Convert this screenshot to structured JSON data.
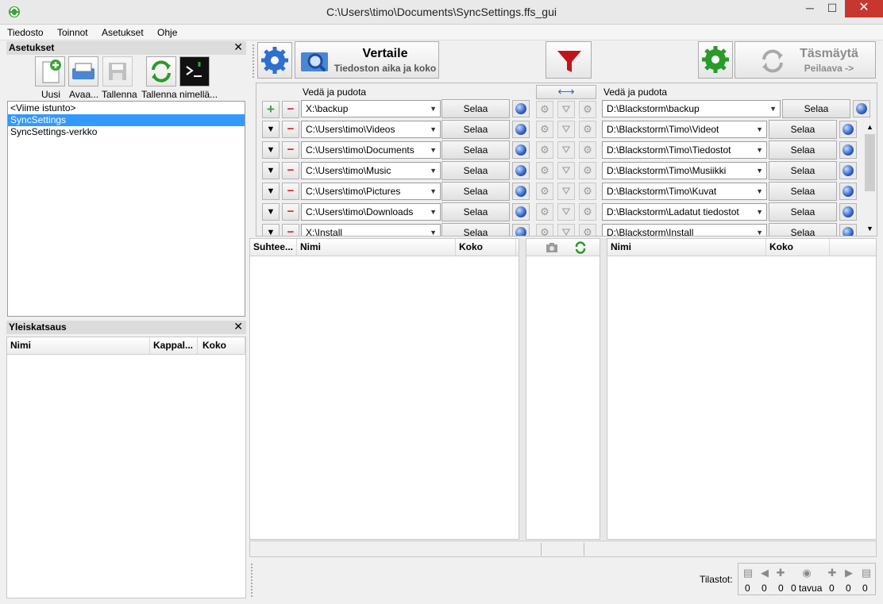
{
  "window": {
    "title": "C:\\Users\\timo\\Documents\\SyncSettings.ffs_gui",
    "minimize": "─",
    "maximize": "☐",
    "close": "✕"
  },
  "menu": [
    "Tiedosto",
    "Toinnot",
    "Asetukset",
    "Ohje"
  ],
  "settings_panel": {
    "title": "Asetukset",
    "close": "✕",
    "buttons": [
      {
        "label": "Uusi"
      },
      {
        "label": "Avaa..."
      },
      {
        "label": "Tallenna"
      },
      {
        "label": "Tallenna nimellä..."
      }
    ],
    "sessions": [
      "<Viime istunto>",
      "SyncSettings",
      "SyncSettings-verkko"
    ],
    "selected": "SyncSettings"
  },
  "overview_panel": {
    "title": "Yleiskatsaus",
    "close": "✕",
    "columns": [
      "Nimi",
      "Kappal...",
      "Koko"
    ]
  },
  "toolbar": {
    "compare_label": "Vertaile",
    "compare_sub": "Tiedoston aika ja koko",
    "sync_label": "Täsmäytä",
    "sync_sub": "Peilaava ->",
    "swap_icon": "⟷"
  },
  "folders": {
    "drag_drop_left": "Vedä ja pudota",
    "drag_drop_right": "Vedä ja pudota",
    "browse": "Selaa",
    "main": {
      "left": "X:\\backup",
      "right": "D:\\Blackstorm\\backup"
    },
    "pairs": [
      {
        "left": "C:\\Users\\timo\\Videos",
        "right": "D:\\Blackstorm\\Timo\\Videot"
      },
      {
        "left": "C:\\Users\\timo\\Documents",
        "right": "D:\\Blackstorm\\Timo\\Tiedostot"
      },
      {
        "left": "C:\\Users\\timo\\Music",
        "right": "D:\\Blackstorm\\Timo\\Musiikki"
      },
      {
        "left": "C:\\Users\\timo\\Pictures",
        "right": "D:\\Blackstorm\\Timo\\Kuvat"
      },
      {
        "left": "C:\\Users\\timo\\Downloads",
        "right": "D:\\Blackstorm\\Ladatut tiedostot"
      },
      {
        "left": "X:\\Install",
        "right": "D:\\Blackstorm\\Install"
      }
    ]
  },
  "grid": {
    "left_columns": [
      "Suhtee...",
      "Nimi",
      "Koko"
    ],
    "right_columns": [
      "Nimi",
      "Koko"
    ]
  },
  "stats": {
    "label": "Tilastot:",
    "values": [
      "0",
      "0",
      "0",
      "0 tavua",
      "0",
      "0",
      "0"
    ]
  },
  "colors": {
    "selection": "#3399ff",
    "close_button": "#c7372f",
    "filter_red": "#c0141c",
    "sync_green": "#2a9a2a"
  }
}
